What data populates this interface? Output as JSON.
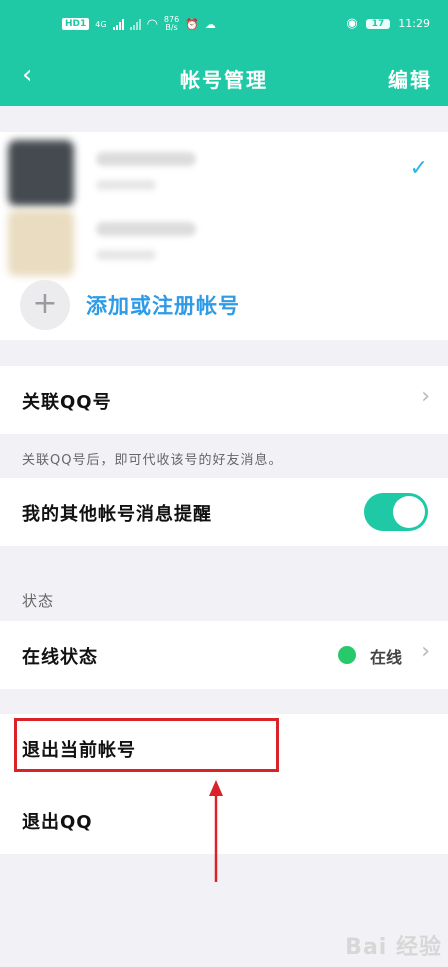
{
  "status_bar": {
    "hd": "HD",
    "hd_sub": "1",
    "network_4g": "4G",
    "speed_value": "876",
    "speed_unit": "B/s",
    "battery": "17",
    "time": "11:29"
  },
  "nav": {
    "back_icon": "chevron-left",
    "title": "帐号管理",
    "edit": "编辑"
  },
  "accounts": {
    "items": [
      {
        "avatar_color": "#444a50",
        "selected": true
      },
      {
        "avatar_color": "#e9dcc0",
        "selected": false
      }
    ],
    "check_icon": "✓",
    "add_label": "添加或注册帐号",
    "add_icon": "+"
  },
  "settings": {
    "link_qq": "关联QQ号",
    "link_hint": "关联QQ号后，即可代收该号的好友消息。",
    "other_notify": "我的其他帐号消息提醒",
    "other_notify_on": true,
    "status_header": "状态",
    "online_status": "在线状态",
    "online_value": "在线",
    "logout_current": "退出当前帐号",
    "logout_qq": "退出QQ"
  },
  "watermark": "Bai 经验",
  "colors": {
    "brand": "#1fc9a5",
    "link_blue": "#2d9be8",
    "online_green": "#27c96b",
    "highlight_red": "#d9232a"
  }
}
